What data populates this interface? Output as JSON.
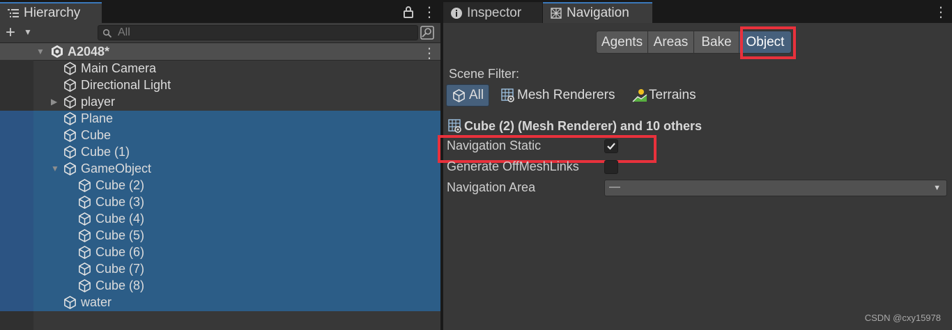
{
  "hierarchy": {
    "tab_title": "Hierarchy",
    "search_placeholder": "All",
    "scene_name": "A2048*",
    "items": [
      {
        "label": "Main Camera"
      },
      {
        "label": "Directional Light"
      },
      {
        "label": "player"
      },
      {
        "label": "Plane"
      },
      {
        "label": "Cube"
      },
      {
        "label": "Cube (1)"
      },
      {
        "label": "GameObject"
      },
      {
        "label": "Cube (2)"
      },
      {
        "label": "Cube (3)"
      },
      {
        "label": "Cube (4)"
      },
      {
        "label": "Cube (5)"
      },
      {
        "label": "Cube (6)"
      },
      {
        "label": "Cube (7)"
      },
      {
        "label": "Cube (8)"
      },
      {
        "label": "water"
      }
    ]
  },
  "right_panel": {
    "tabs": [
      {
        "label": "Inspector"
      },
      {
        "label": "Navigation"
      }
    ],
    "segments": [
      {
        "label": "Agents"
      },
      {
        "label": "Areas"
      },
      {
        "label": "Bake"
      },
      {
        "label": "Object"
      }
    ],
    "scene_filter_label": "Scene Filter:",
    "filters": [
      {
        "label": "All"
      },
      {
        "label": "Mesh Renderers"
      },
      {
        "label": "Terrains"
      }
    ],
    "selection_header": "Cube (2) (Mesh Renderer) and 10 others",
    "fields": {
      "nav_static": "Navigation Static",
      "offmesh": "Generate OffMeshLinks",
      "nav_area": "Navigation Area",
      "nav_area_value": "—"
    },
    "nav_static_checked": true,
    "offmesh_checked": false
  },
  "watermark": "CSDN @cxy15978",
  "colors": {
    "accent_selection": "#2c5d87",
    "highlight_red": "#e8313c",
    "segment_active": "#46607c"
  }
}
